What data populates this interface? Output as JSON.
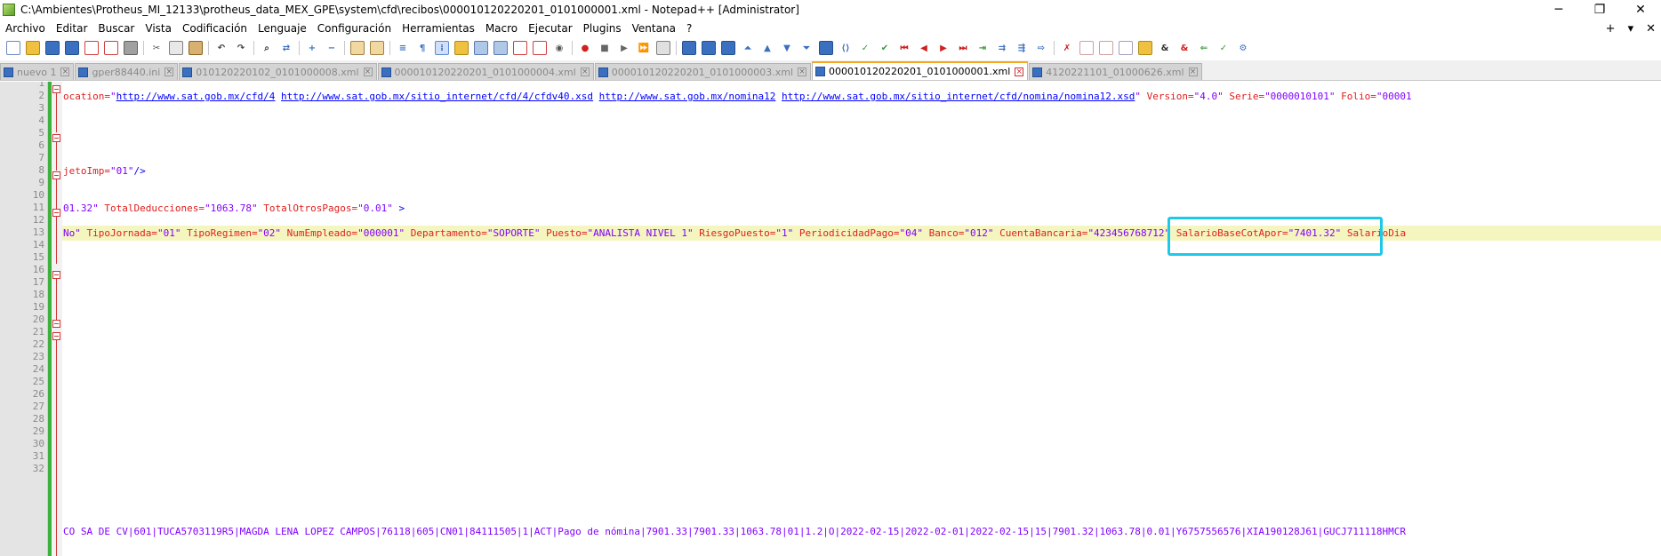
{
  "window": {
    "title": "C:\\Ambientes\\Protheus_MI_12133\\protheus_data_MEX_GPE\\system\\cfd\\recibos\\000010120220201_0101000001.xml - Notepad++ [Administrator]",
    "minimize_glyph": "─",
    "restore_glyph": "❐",
    "close_glyph": "✕"
  },
  "menu": {
    "items": [
      "Archivo",
      "Editar",
      "Buscar",
      "Vista",
      "Codificación",
      "Lenguaje",
      "Configuración",
      "Herramientas",
      "Macro",
      "Ejecutar",
      "Plugins",
      "Ventana",
      "?"
    ],
    "right_plus": "+",
    "right_down": "▾",
    "right_close": "✕"
  },
  "tabs": [
    {
      "label": "nuevo 1",
      "active": false
    },
    {
      "label": "gper88440.ini",
      "active": false
    },
    {
      "label": "010120220102_0101000008.xml",
      "active": false
    },
    {
      "label": "000010120220201_0101000004.xml",
      "active": false
    },
    {
      "label": "000010120220201_0101000003.xml",
      "active": false
    },
    {
      "label": "000010120220201_0101000001.xml",
      "active": true
    },
    {
      "label": "4120221101_01000626.xml",
      "active": false
    }
  ],
  "editor": {
    "line_numbers": [
      "1",
      "2",
      "3",
      "4",
      "5",
      "6",
      "7",
      "8",
      "9",
      "10",
      "11",
      "12",
      "13",
      "14",
      "15",
      "16",
      "17",
      "18",
      "19",
      "20",
      "21",
      "22",
      "23",
      "24",
      "25",
      "26",
      "27",
      "28",
      "29",
      "30",
      "31",
      "32"
    ],
    "line2": {
      "a1": "ocation=",
      "v1": "\"",
      "u1": "http://www.sat.gob.mx/cfd/4",
      "s1": " ",
      "u2": "http://www.sat.gob.mx/sitio_internet/cfd/4/cfdv40.xsd",
      "s2": " ",
      "u3": "http://www.sat.gob.mx/nomina12",
      "s3": " ",
      "u4": "http://www.sat.gob.mx/sitio_internet/cfd/nomina/nomina12.xsd",
      "v2": "\"",
      "a2": " Version=",
      "v3": "\"4.0\"",
      "a3": " Serie=",
      "v4": "\"0000010101\"",
      "a4": " Folio=",
      "v5": "\"00001"
    },
    "line7": {
      "a1": "jetoImp=",
      "v1": "\"01\"",
      "t1": "/>"
    },
    "line10": {
      "v0": "01.32\"",
      "a1": " TotalDeducciones=",
      "v1": "\"1063.78\"",
      "a2": " TotalOtrosPagos=",
      "v2": "\"0.01\"",
      "t1": " >"
    },
    "line12": {
      "v0": "No\"",
      "a1": " TipoJornada=",
      "v1": "\"01\"",
      "a2": " TipoRegimen=",
      "v2": "\"02\"",
      "a3": " NumEmpleado=",
      "v3": "\"000001\"",
      "a4": " Departamento=",
      "v4": "\"SOPORTE\"",
      "a5": " Puesto=",
      "v5": "\"ANALISTA NIVEL 1\"",
      "a6": " RiesgoPuesto=",
      "v6": "\"1\"",
      "a7": " PeriodicidadPago=",
      "v7": "\"04\"",
      "a8": " Banco=",
      "v8": "\"012\"",
      "a9": " CuentaBancaria=",
      "v9": "\"423456768712\"",
      "a10": " SalarioBaseCotApor=",
      "v10": "\"7401.32\"",
      "a11": " SalarioDia"
    },
    "line30": "CO SA DE CV|601|TUCA5703119R5|MAGDA LENA LOPEZ CAMPOS|76118|605|CN01|84111505|1|ACT|Pago de nómina|7901.33|7901.33|1063.78|01|1.2|O|2022-02-15|2022-02-01|2022-02-15|15|7901.32|1063.78|0.01|Y6757556576|XIA190128J61|GUCJ711118HMCR"
  },
  "colors": {
    "attr": "#e01e1e",
    "value": "#8000ff",
    "url": "#0000ff",
    "highlight": "#1ec8e8",
    "active_tab_accent": "#f5a623"
  }
}
